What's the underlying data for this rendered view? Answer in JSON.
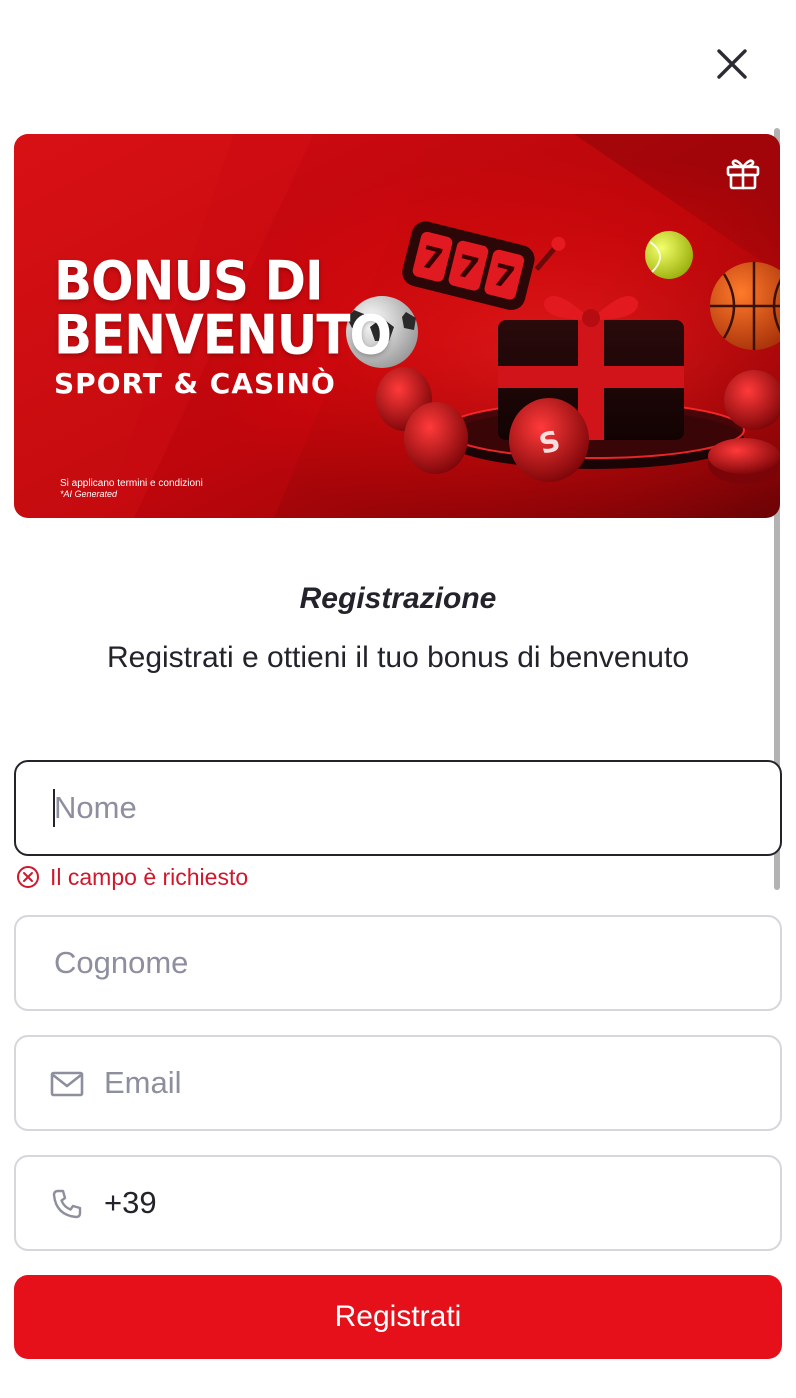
{
  "banner": {
    "title_line1": "BONUS DI",
    "title_line2": "BENVENUTO",
    "subtitle": "SPORT & CASINÒ",
    "terms": "Si applicano termini e condizioni",
    "ai_note": "*AI Generated",
    "slot_digits": "777"
  },
  "registration": {
    "title": "Registrazione",
    "subtitle": "Registrati e ottieni il tuo bonus di benvenuto"
  },
  "form": {
    "first_name": {
      "placeholder": "Nome",
      "value": ""
    },
    "first_name_error": "Il campo è richiesto",
    "last_name": {
      "placeholder": "Cognome",
      "value": ""
    },
    "email": {
      "placeholder": "Email",
      "value": ""
    },
    "phone": {
      "placeholder": "",
      "value": "+39"
    },
    "submit_label": "Registrati"
  },
  "colors": {
    "accent": "#e6101b",
    "error": "#d0172b",
    "text": "#23232b",
    "placeholder": "#8d8f9e",
    "border": "#d6d6db"
  },
  "icons": {
    "close": "close-icon",
    "gift": "gift-icon",
    "error": "error-circle-icon",
    "email": "envelope-icon",
    "phone": "phone-icon"
  }
}
